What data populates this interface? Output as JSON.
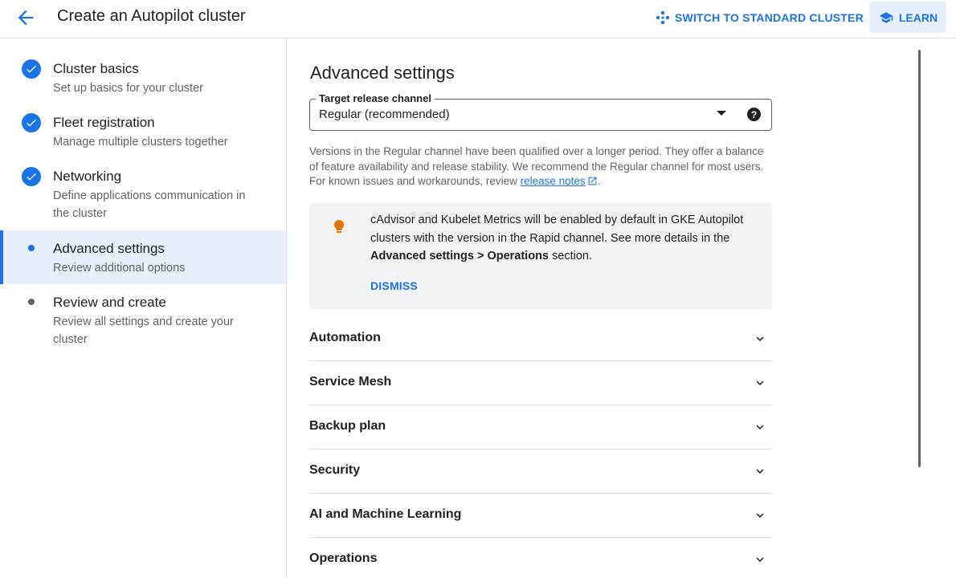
{
  "header": {
    "title": "Create an Autopilot cluster",
    "switch_label": "SWITCH TO STANDARD CLUSTER",
    "learn_label": "LEARN"
  },
  "sidebar": {
    "steps": [
      {
        "title": "Cluster basics",
        "subtitle": "Set up basics for your cluster",
        "status": "complete"
      },
      {
        "title": "Fleet registration",
        "subtitle": "Manage multiple clusters together",
        "status": "complete"
      },
      {
        "title": "Networking",
        "subtitle": "Define applications communication in the cluster",
        "status": "complete"
      },
      {
        "title": "Advanced settings",
        "subtitle": "Review additional options",
        "status": "current"
      },
      {
        "title": "Review and create",
        "subtitle": "Review all settings and create your cluster",
        "status": "pending"
      }
    ]
  },
  "main": {
    "title": "Advanced settings",
    "release_channel": {
      "label": "Target release channel",
      "value": "Regular (recommended)",
      "help": "?"
    },
    "description": {
      "text": "Versions in the Regular channel have been qualified over a longer period. They offer a balance of feature availability and release stability. We recommend the Regular channel for most users. For known issues and workarounds, review ",
      "link": "release notes",
      "suffix": "."
    },
    "banner": {
      "text": "cAdvisor and Kubelet Metrics will be enabled by default in GKE Autopilot clusters with the version in the Rapid channel. See more details in the ",
      "bold": "Advanced settings > Operations",
      "suffix": " section.",
      "dismiss": "DISMISS"
    },
    "sections": [
      "Automation",
      "Service Mesh",
      "Backup plan",
      "Security",
      "AI and Machine Learning",
      "Operations"
    ]
  },
  "colors": {
    "accent": "#1a73e8",
    "bulb": "#e37400",
    "pending_dot": "#5f6368"
  }
}
